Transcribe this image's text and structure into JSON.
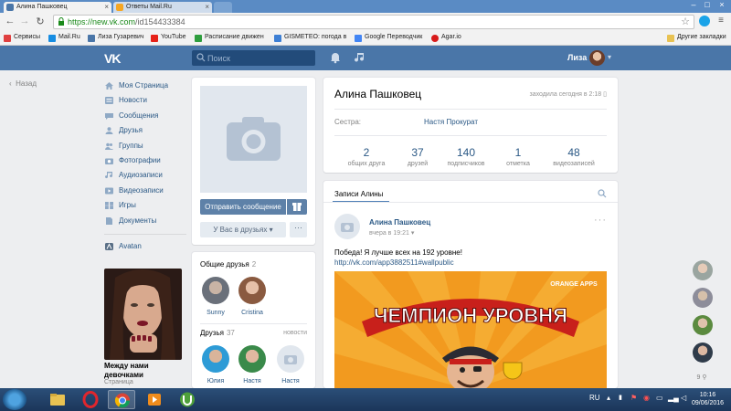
{
  "browser": {
    "tabs": [
      {
        "label": "Алина Пашковец",
        "active": true
      },
      {
        "label": "Ответы Mail.Ru",
        "active": false
      }
    ],
    "url_host": "https://new.vk.com",
    "url_path": "/id154433384",
    "bookmarks": [
      "Сервисы",
      "Mail.Ru",
      "Лиза Гузаревич",
      "YouTube",
      "Расписание движен",
      "GISMETEO: погода в",
      "Google Переводчик",
      "Agar.io",
      "Другие закладки"
    ]
  },
  "header": {
    "logo": "VK",
    "search_placeholder": "Поиск",
    "user_name": "Лиза"
  },
  "back_label": "Назад",
  "nav": [
    {
      "label": "Моя Страница",
      "icon": "home-icon"
    },
    {
      "label": "Новости",
      "icon": "news-icon"
    },
    {
      "label": "Сообщения",
      "icon": "message-icon"
    },
    {
      "label": "Друзья",
      "icon": "friends-icon"
    },
    {
      "label": "Группы",
      "icon": "groups-icon"
    },
    {
      "label": "Фотографии",
      "icon": "camera-icon"
    },
    {
      "label": "Аудиозаписи",
      "icon": "music-icon"
    },
    {
      "label": "Видеозаписи",
      "icon": "video-icon"
    },
    {
      "label": "Игры",
      "icon": "games-icon"
    },
    {
      "label": "Документы",
      "icon": "documents-icon"
    }
  ],
  "nav_app": "Avatan",
  "ad": {
    "title": "Между нами девочками",
    "subtitle": "Страница"
  },
  "profile": {
    "name": "Алина Пашковец",
    "online": "заходила сегодня в 2:18",
    "relation_label": "Сестра:",
    "relation_value": "Настя Прокурат",
    "counters": [
      {
        "num": "2",
        "label": "общих друга"
      },
      {
        "num": "37",
        "label": "друзей"
      },
      {
        "num": "140",
        "label": "подписчиков"
      },
      {
        "num": "1",
        "label": "отметка"
      },
      {
        "num": "48",
        "label": "видеозаписей"
      }
    ]
  },
  "actions": {
    "send_message": "Отправить сообщение",
    "in_friends": "У Вас в друзьях",
    "more": "···"
  },
  "common_friends": {
    "title": "Общие друзья",
    "count": "2",
    "items": [
      {
        "name": "Sunny"
      },
      {
        "name": "Cristina"
      }
    ]
  },
  "friends": {
    "title": "Друзья",
    "count": "37",
    "news": "новости",
    "items": [
      {
        "name": "Юлия"
      },
      {
        "name": "Настя"
      },
      {
        "name": "Настя"
      }
    ]
  },
  "wall": {
    "tab": "Записи Алины",
    "post": {
      "author": "Алина Пашковец",
      "date": "вчера в 19:21",
      "text": "Победа! Я лучше всех на 192 уровне!",
      "link": "http://vk.com/app3882511#wallpublic",
      "image_title": "ЧЕМПИОН УРОВНЯ",
      "image_brand": "ORANGE APPS"
    }
  },
  "chat_count": "9",
  "taskbar": {
    "lang": "RU",
    "time": "10:16",
    "date": "09/06/2016"
  },
  "colors": {
    "vk_blue": "#4a76a8",
    "link": "#2a5885",
    "button": "#5e81a8",
    "page_bg": "#edeef0"
  }
}
